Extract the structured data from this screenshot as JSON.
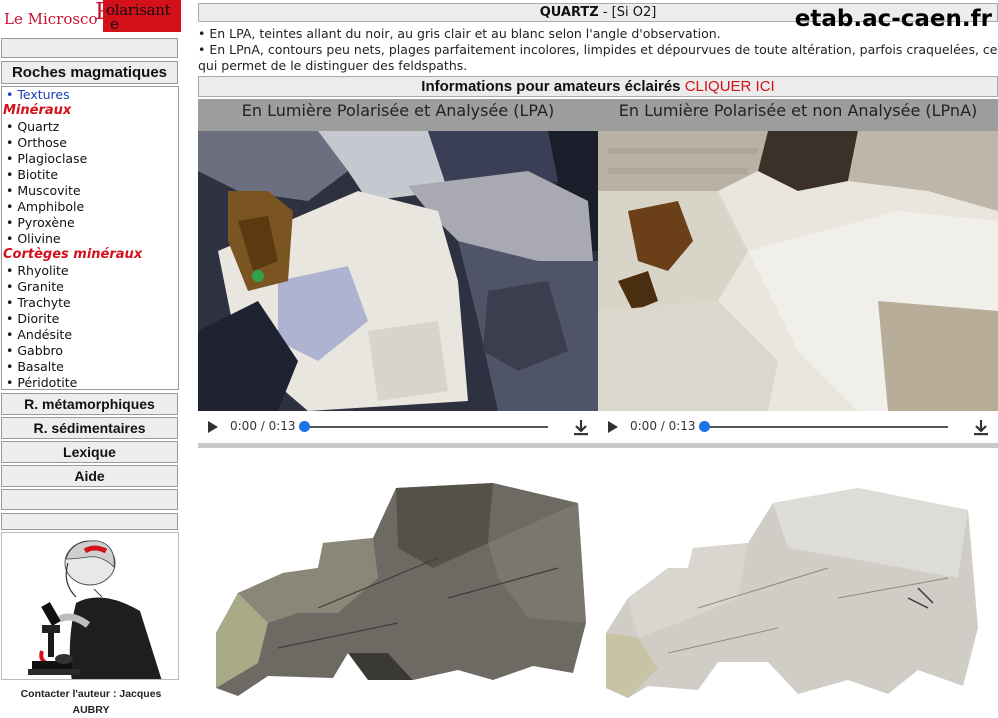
{
  "logo": {
    "part1": "Le Microsco",
    "big_letter": "P",
    "part2": "olarisant",
    "part3": "e"
  },
  "site": "etab.ac-caen.fr",
  "sidebar": {
    "magmatic_button": "Roches magmatiques",
    "menu": [
      {
        "label": "• Textures",
        "kind": "link"
      },
      {
        "label": "Minéraux",
        "kind": "section"
      },
      {
        "label": "• Quartz",
        "kind": "item"
      },
      {
        "label": "• Orthose",
        "kind": "item"
      },
      {
        "label": "• Plagioclase",
        "kind": "item"
      },
      {
        "label": "• Biotite",
        "kind": "item"
      },
      {
        "label": "• Muscovite",
        "kind": "item"
      },
      {
        "label": "• Amphibole",
        "kind": "item"
      },
      {
        "label": "• Pyroxène",
        "kind": "item"
      },
      {
        "label": "• Olivine",
        "kind": "item"
      },
      {
        "label": "Cortèges minéraux",
        "kind": "section"
      },
      {
        "label": "• Rhyolite",
        "kind": "item"
      },
      {
        "label": "• Granite",
        "kind": "item"
      },
      {
        "label": "• Trachyte",
        "kind": "item"
      },
      {
        "label": "• Diorite",
        "kind": "item"
      },
      {
        "label": "• Andésite",
        "kind": "item"
      },
      {
        "label": "• Gabbro",
        "kind": "item"
      },
      {
        "label": "• Basalte",
        "kind": "item"
      },
      {
        "label": "• Péridotite",
        "kind": "item"
      }
    ],
    "metamorphic_button": "R. métamorphiques",
    "sedimentary_button": "R. sédimentaires",
    "lexicon_button": "Lexique",
    "help_button": "Aide",
    "contact_line1": "Contacter l'auteur : Jacques",
    "contact_line2": "AUBRY"
  },
  "header": {
    "mineral": "QUARTZ",
    "formula": " - [Si O2]"
  },
  "description": [
    "• En LPA, teintes allant du noir, au gris clair et au blanc selon l'angle d'observation.",
    "• En LPnA, contours peu nets, plages parfaitement incolores, limpides et dépourvues de toute altération, parfois craquelées, ce qui permet de le distinguer des feldspaths."
  ],
  "info_bar": {
    "text": "Informations pour amateurs éclairés ",
    "link": "CLIQUER ICI"
  },
  "panels": {
    "left_title": "En Lumière Polarisée et Analysée (LPA)",
    "right_title": "En Lumière Polarisée et non Analysée (LPnA)"
  },
  "player": {
    "time": "0:00 / 0:13",
    "progress": 0
  }
}
